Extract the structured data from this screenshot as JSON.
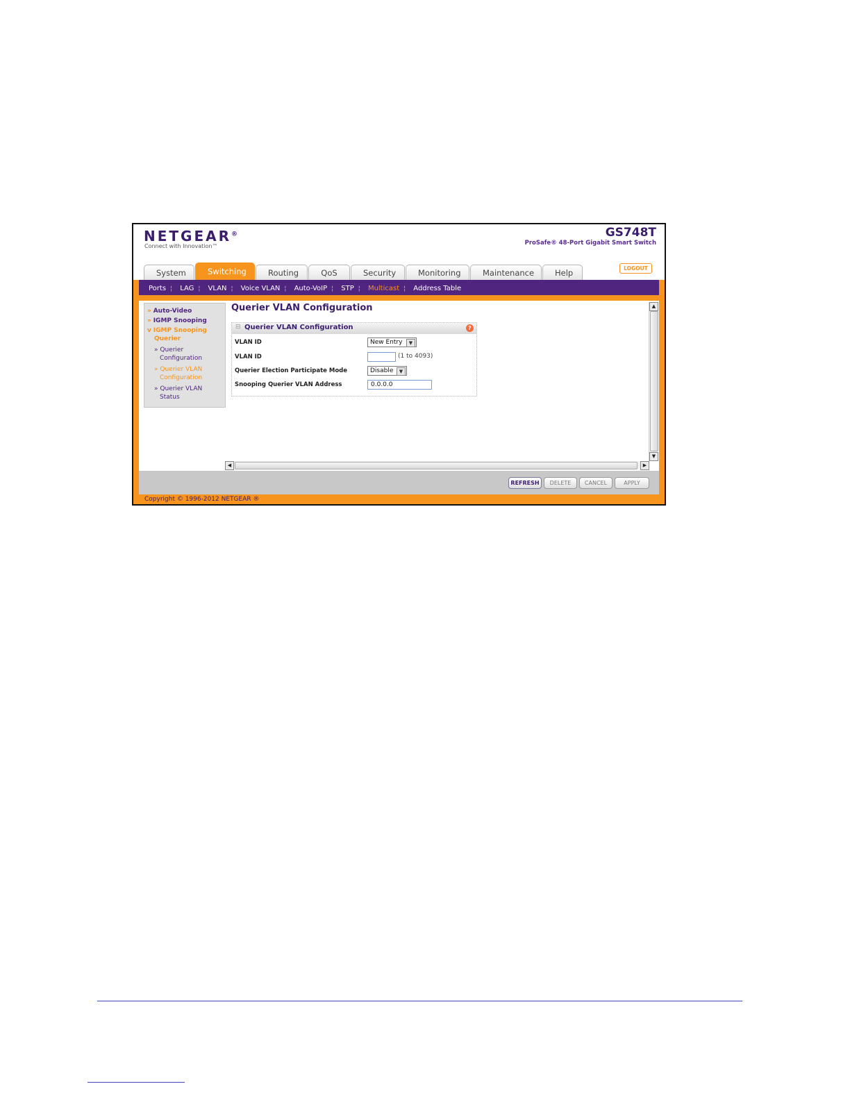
{
  "header": {
    "brand": "NETGEAR",
    "brand_mark": "®",
    "tagline": "Connect with Innovation™",
    "model": "GS748T",
    "model_description": "ProSafe® 48-Port Gigabit Smart Switch",
    "logout_label": "LOGOUT"
  },
  "tabs": [
    {
      "label": "System"
    },
    {
      "label": "Switching",
      "active": true
    },
    {
      "label": "Routing"
    },
    {
      "label": "QoS"
    },
    {
      "label": "Security"
    },
    {
      "label": "Monitoring"
    },
    {
      "label": "Maintenance"
    },
    {
      "label": "Help"
    }
  ],
  "subnav": [
    {
      "label": "Ports"
    },
    {
      "label": "LAG"
    },
    {
      "label": "VLAN"
    },
    {
      "label": "Voice VLAN"
    },
    {
      "label": "Auto-VoIP"
    },
    {
      "label": "STP"
    },
    {
      "label": "Multicast",
      "active": true
    },
    {
      "label": "Address Table"
    }
  ],
  "sidebar": {
    "items": [
      {
        "label": "Auto-Video",
        "arrow": "»"
      },
      {
        "label": "IGMP Snooping",
        "arrow": "»"
      },
      {
        "label": "IGMP Snooping",
        "arrow": "v",
        "continuation": "Querier"
      },
      {
        "label": "Querier",
        "continuation": "Configuration",
        "arrow": "»"
      },
      {
        "label": "Querier VLAN",
        "continuation": "Configuration",
        "arrow": "»",
        "active": true
      },
      {
        "label": "Querier VLAN",
        "continuation": "Status",
        "arrow": "»"
      }
    ]
  },
  "main": {
    "page_title": "Querier VLAN Configuration",
    "panel_title": "Querier VLAN Configuration",
    "help_icon": "?",
    "collapse_icon": "minus-icon",
    "fields": [
      {
        "label": "VLAN ID",
        "type": "select",
        "value": "New Entry"
      },
      {
        "label": "VLAN ID",
        "type": "text",
        "value": "",
        "hint": "(1 to 4093)"
      },
      {
        "label": "Querier Election Participate Mode",
        "type": "select",
        "value": "Disable"
      },
      {
        "label": "Snooping Querier VLAN Address",
        "type": "text",
        "value": "0.0.0.0"
      }
    ]
  },
  "actions": {
    "refresh": "REFRESH",
    "delete": "DELETE",
    "cancel": "CANCEL",
    "apply": "APPLY"
  },
  "footer": {
    "copyright": "Copyright © 1996-2012 NETGEAR ®"
  },
  "colors": {
    "brand_purple": "#4f2580",
    "accent_orange": "#f7941d"
  }
}
